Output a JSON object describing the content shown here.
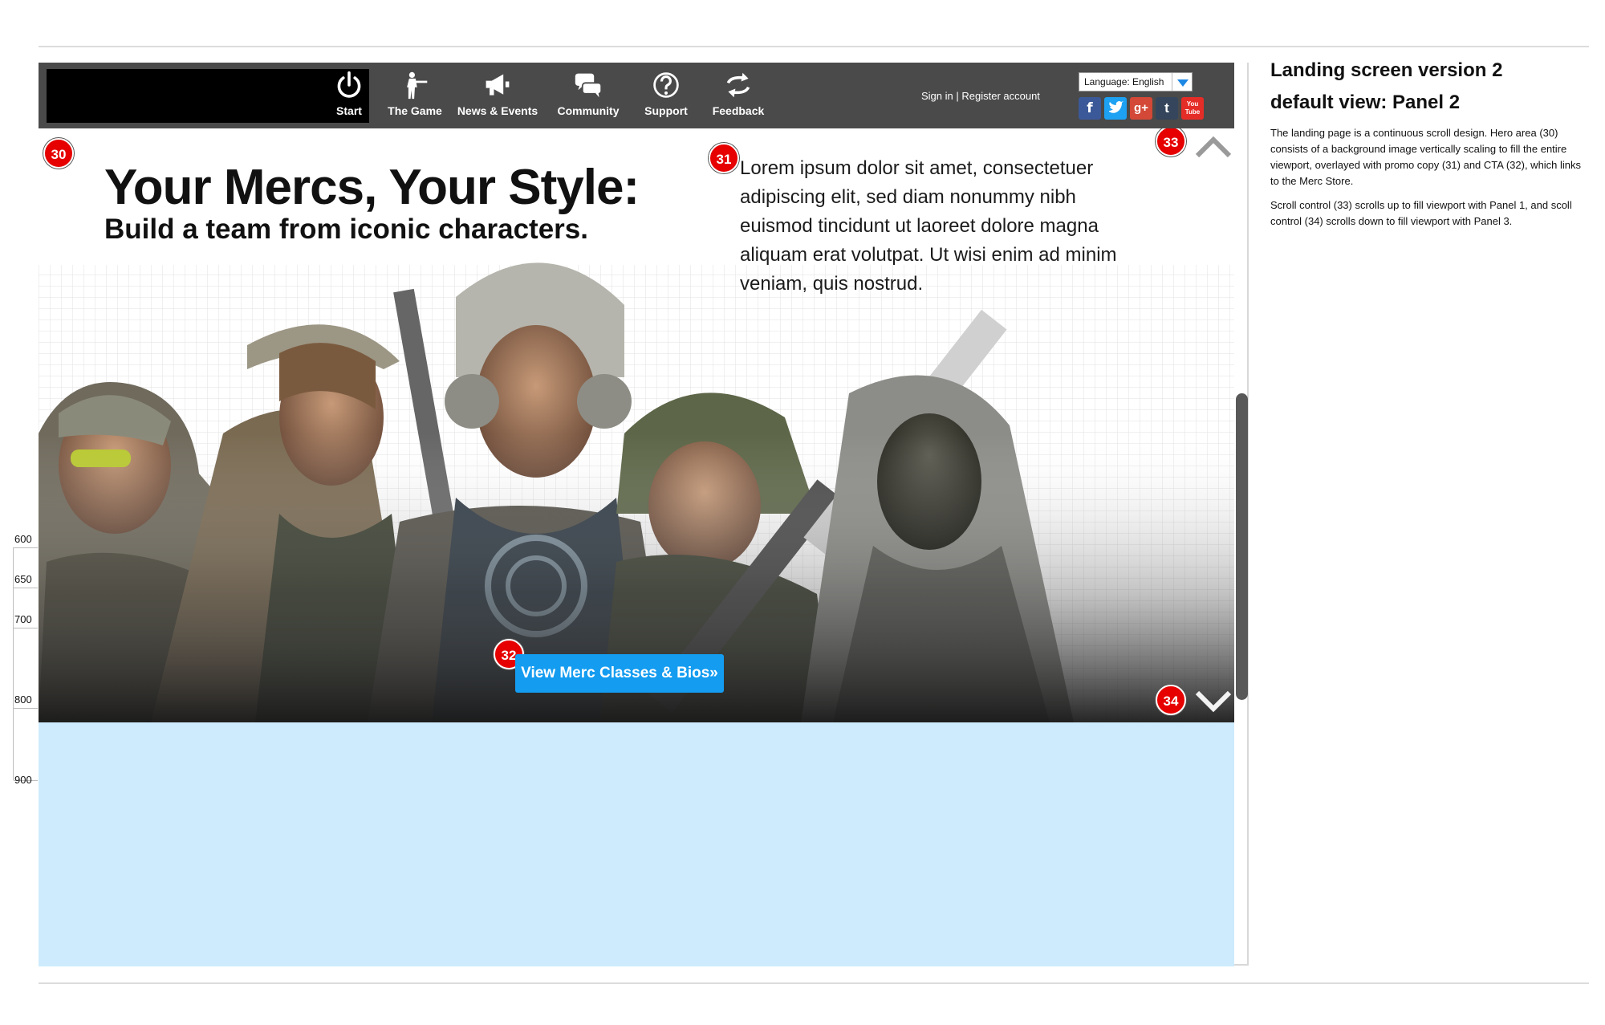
{
  "header": {
    "nav": [
      {
        "label": "Start",
        "icon": "power-icon"
      },
      {
        "label": "The Game",
        "icon": "soldier-icon"
      },
      {
        "label": "News & Events",
        "icon": "megaphone-icon"
      },
      {
        "label": "Community",
        "icon": "chat-bubbles-icon"
      },
      {
        "label": "Support",
        "icon": "question-icon"
      },
      {
        "label": "Feedback",
        "icon": "refresh-arrows-icon"
      }
    ],
    "sign_in": "Sign in",
    "separator": " | ",
    "register": "Register account",
    "language_select": "Language: English",
    "social": [
      {
        "label": "f",
        "icon": "facebook-icon",
        "color": "#3b5998"
      },
      {
        "label": "t",
        "icon": "twitter-icon",
        "color": "#1da1f2"
      },
      {
        "label": "g+",
        "icon": "google-plus-icon",
        "color": "#d34836"
      },
      {
        "label": "t",
        "icon": "tumblr-icon",
        "color": "#35465c"
      },
      {
        "label": "You Tube",
        "icon": "youtube-icon",
        "color": "#e52d27"
      }
    ]
  },
  "hero": {
    "badge_hero": "30",
    "badge_promo": "31",
    "badge_cta": "32",
    "badge_up": "33",
    "badge_down": "34",
    "headline": "Your Mercs, Your Style:",
    "subheadline": "Build a team from iconic characters.",
    "promo_copy": "Lorem ipsum dolor sit amet, consectetuer adipiscing elit, sed diam nonummy nibh euismod tincidunt ut laoreet dolore magna aliquam erat volutpat. Ut wisi enim ad minim veniam, quis nostrud.",
    "cta_label": "View Merc Classes & Bios",
    "cta_suffix": "»"
  },
  "ruler": [
    "600",
    "650",
    "700",
    "800",
    "900"
  ],
  "annotation": {
    "title": "Landing screen version 2",
    "subtitle": "default view: Panel 2",
    "para1": "The landing page is a continuous scroll design. Hero area (30) consists of a background image vertically scaling to fill the entire viewport, overlayed with promo copy (31) and CTA (32), which links to the Merc Store.",
    "para2": "Scroll control (33) scrolls up to fill viewport with Panel 1, and scoll control (34) scrolls down to fill viewport with Panel 3."
  },
  "colors": {
    "header_bg": "#4a4a4a",
    "badge": "#e60000",
    "cta": "#149cf0",
    "panel3_bg": "#cdebfc"
  }
}
